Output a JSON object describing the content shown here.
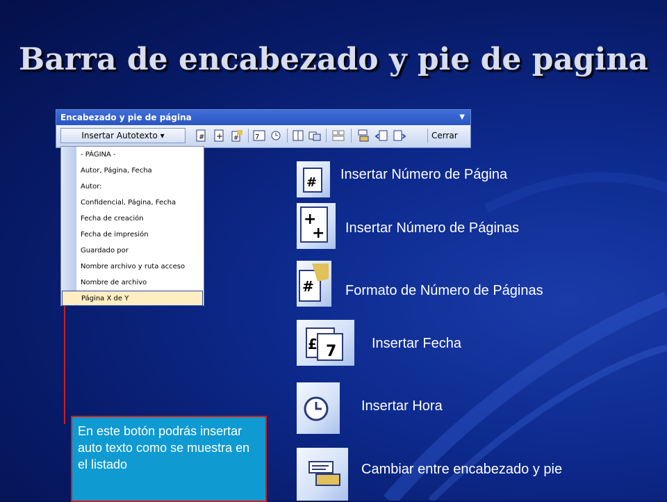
{
  "slide": {
    "title": "Barra de encabezado y pie de pagina"
  },
  "toolbar": {
    "title": "Encabezado y pie de página",
    "menu_arrow": "▼",
    "autotext_button": "Insertar Autotexto ▾",
    "close_label": "Cerrar",
    "icons": [
      {
        "name": "page-number-icon",
        "glyph": "#"
      },
      {
        "name": "page-count-icon",
        "glyph": "+"
      },
      {
        "name": "page-format-icon",
        "glyph": "#"
      },
      {
        "name": "date-icon",
        "glyph": "7"
      },
      {
        "name": "time-icon",
        "glyph": "◷"
      },
      {
        "name": "page-setup-icon",
        "glyph": "▯"
      },
      {
        "name": "show-text-icon",
        "glyph": "▭"
      },
      {
        "name": "link-previous-icon",
        "glyph": "▤"
      },
      {
        "name": "switch-header-footer-icon",
        "glyph": "▤"
      },
      {
        "name": "show-previous-icon",
        "glyph": "◂"
      },
      {
        "name": "show-next-icon",
        "glyph": "▸"
      }
    ]
  },
  "dropdown": {
    "items": [
      "- PÁGINA -",
      "Autor, Página, Fecha",
      "Autor:",
      "Confidencial, Página, Fecha",
      "Fecha de creación",
      "Fecha de impresión",
      "Guardado por",
      "Nombre archivo y ruta acceso",
      "Nombre de archivo",
      "Página X de Y"
    ],
    "selected_index": 9
  },
  "callout": {
    "text": "En este botón podrás insertar auto texto como se muestra en el listado"
  },
  "legend": [
    {
      "label": "Insertar Número de Página",
      "icon": "page-number-icon"
    },
    {
      "label": "Insertar Número de Páginas",
      "icon": "page-count-icon"
    },
    {
      "label": "Formato de Número de Páginas",
      "icon": "page-format-icon"
    },
    {
      "label": "Insertar Fecha",
      "icon": "date-icon"
    },
    {
      "label": "Insertar Hora",
      "icon": "time-icon"
    },
    {
      "label": "Cambiar entre encabezado y pie",
      "icon": "switch-header-footer-icon"
    }
  ],
  "colors": {
    "background": "#0d2a8e",
    "callout_bg": "#0f9ad1",
    "callout_border": "#cc1f1f",
    "toolbar_header": "#2a55c0",
    "selected_item_bg": "#ffeec2"
  }
}
